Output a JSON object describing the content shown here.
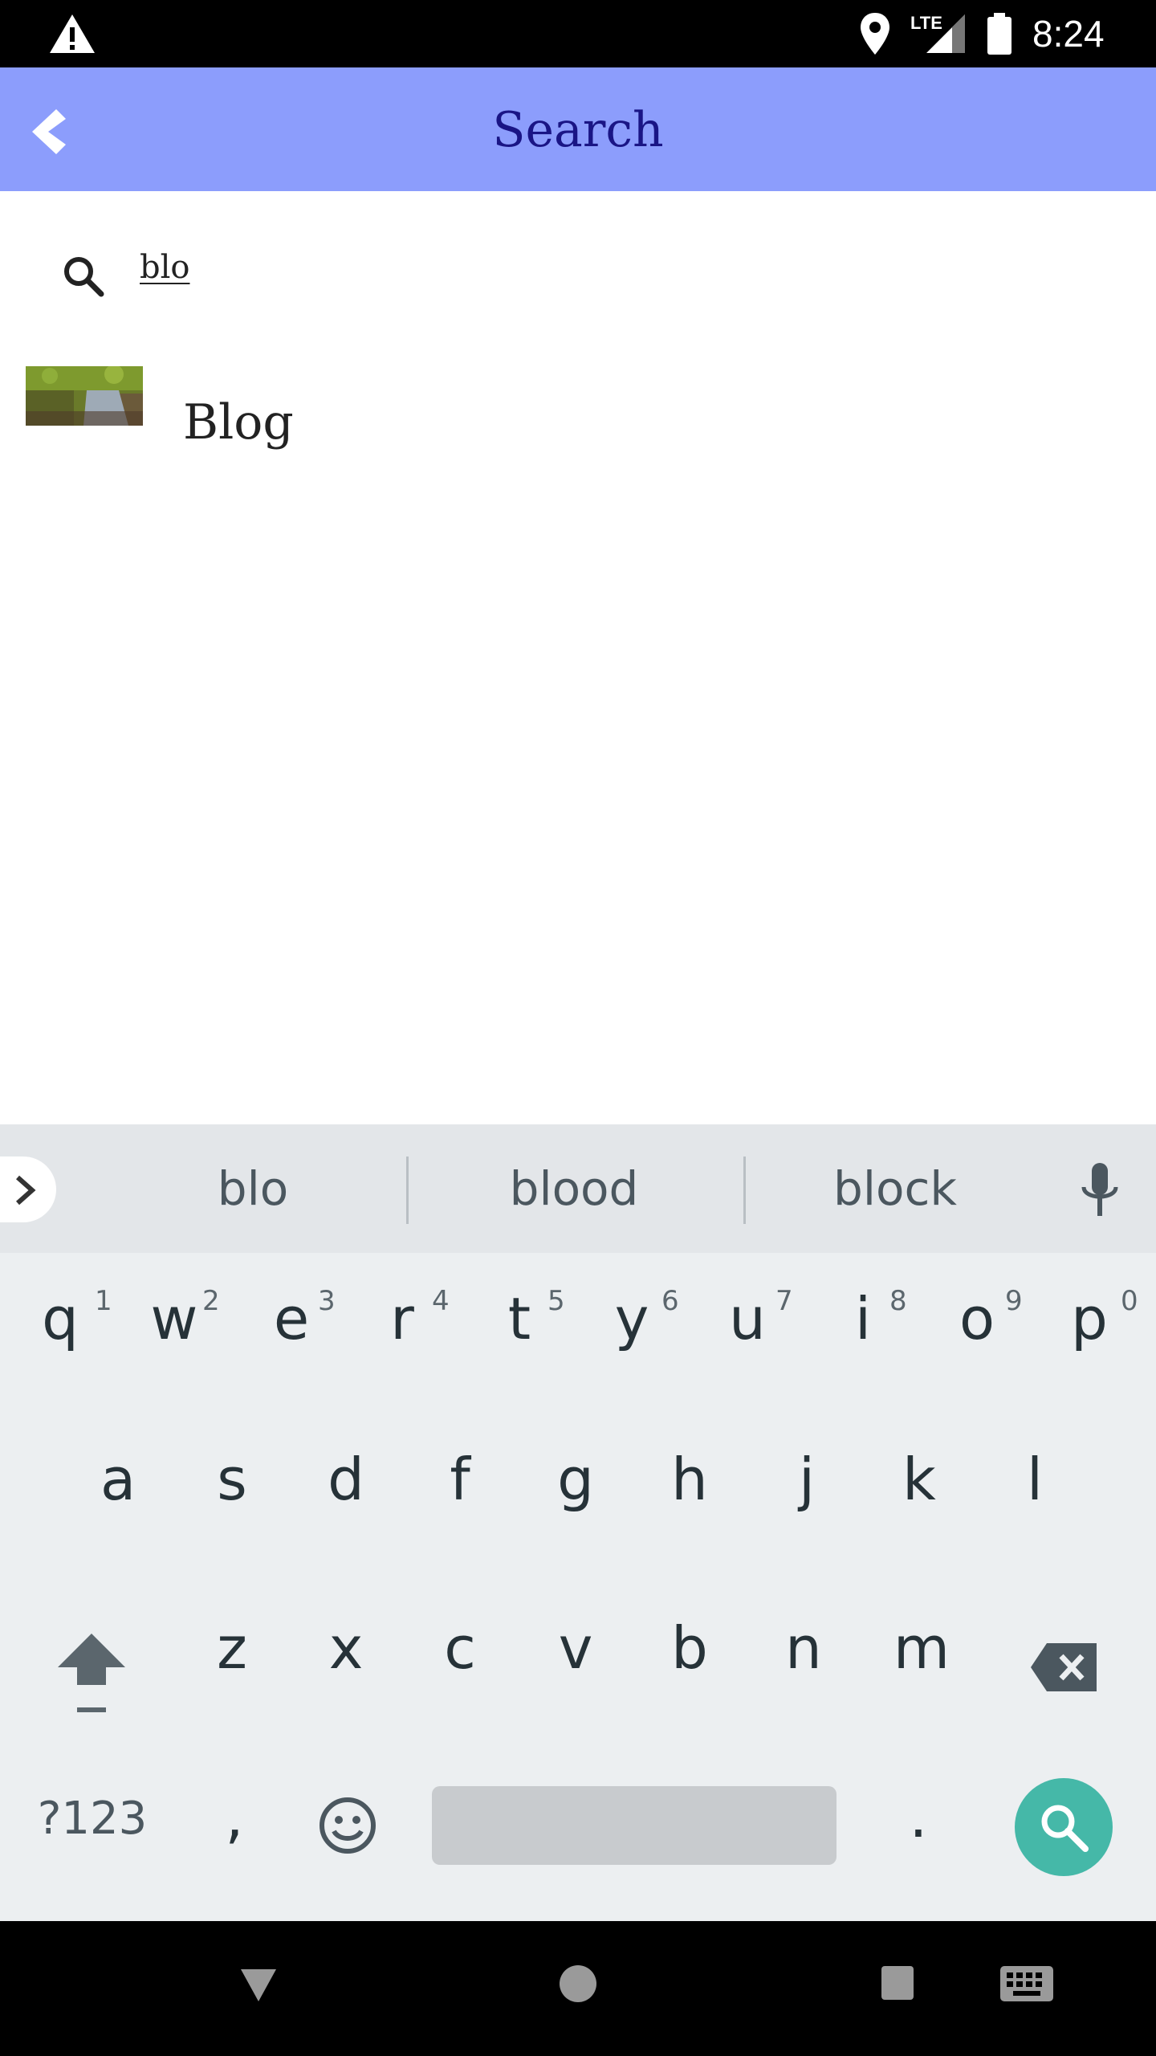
{
  "status_bar": {
    "time": "8:24",
    "network": "LTE",
    "icons": [
      "warning-icon",
      "location-icon",
      "signal-icon",
      "battery-icon"
    ]
  },
  "app_bar": {
    "title": "Search",
    "back_icon": "back-chevron-icon",
    "background": "#8c9dfc",
    "title_color": "#1a1585"
  },
  "search": {
    "query": "blo",
    "icon": "search-icon"
  },
  "results": [
    {
      "label": "Blog",
      "thumbnail": "garden-path-thumbnail"
    }
  ],
  "keyboard": {
    "suggestions": [
      "blo",
      "blood",
      "block"
    ],
    "row1": [
      {
        "key": "q",
        "hint": "1"
      },
      {
        "key": "w",
        "hint": "2"
      },
      {
        "key": "e",
        "hint": "3"
      },
      {
        "key": "r",
        "hint": "4"
      },
      {
        "key": "t",
        "hint": "5"
      },
      {
        "key": "y",
        "hint": "6"
      },
      {
        "key": "u",
        "hint": "7"
      },
      {
        "key": "i",
        "hint": "8"
      },
      {
        "key": "o",
        "hint": "9"
      },
      {
        "key": "p",
        "hint": "0"
      }
    ],
    "row2": [
      "a",
      "s",
      "d",
      "f",
      "g",
      "h",
      "j",
      "k",
      "l"
    ],
    "row3": [
      "z",
      "x",
      "c",
      "v",
      "b",
      "n",
      "m"
    ],
    "symbols_label": "?123",
    "comma": ",",
    "period": ".",
    "accent": "#45b8a8"
  },
  "nav_bar": {
    "icons": [
      "back-triangle-icon",
      "home-circle-icon",
      "recents-square-icon",
      "keyboard-switch-icon"
    ]
  }
}
